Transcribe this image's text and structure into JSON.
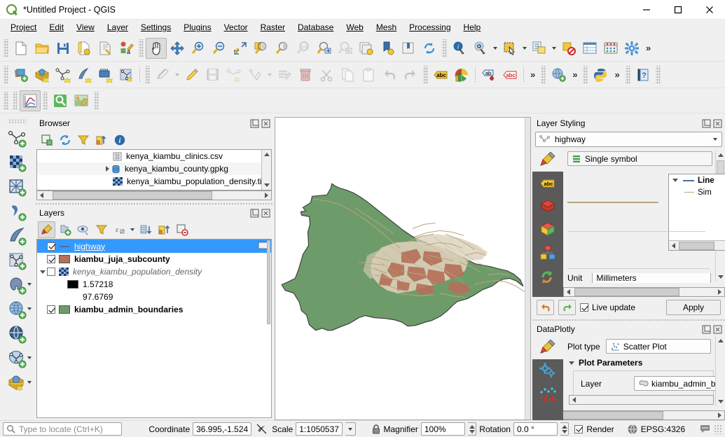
{
  "window": {
    "title": "*Untitled Project - QGIS",
    "app_icon": "qgis-logo",
    "minimize": "minimize-icon",
    "maximize": "maximize-icon",
    "close": "close-icon"
  },
  "menubar": {
    "items": [
      {
        "label": "Project"
      },
      {
        "label": "Edit"
      },
      {
        "label": "View"
      },
      {
        "label": "Layer"
      },
      {
        "label": "Settings"
      },
      {
        "label": "Plugins"
      },
      {
        "label": "Vector"
      },
      {
        "label": "Raster"
      },
      {
        "label": "Database"
      },
      {
        "label": "Web"
      },
      {
        "label": "Mesh"
      },
      {
        "label": "Processing"
      },
      {
        "label": "Help"
      }
    ]
  },
  "toolbar_project": [
    {
      "name": "new-project-icon"
    },
    {
      "name": "open-project-icon"
    },
    {
      "name": "save-project-icon"
    },
    {
      "name": "new-print-layout-icon"
    },
    {
      "name": "style-manager-icon"
    },
    {
      "name": "show-style-manager-icon"
    }
  ],
  "toolbar_navigation": [
    {
      "name": "pan-map-icon",
      "active": true
    },
    {
      "name": "pan-to-selection-icon"
    },
    {
      "name": "zoom-in-icon"
    },
    {
      "name": "zoom-out-icon"
    },
    {
      "name": "zoom-full-icon"
    },
    {
      "name": "zoom-to-selection-icon"
    },
    {
      "name": "zoom-to-layer-icon"
    },
    {
      "name": "zoom-native-icon"
    },
    {
      "name": "zoom-last-icon"
    },
    {
      "name": "zoom-next-icon"
    },
    {
      "name": "refresh-map-icon"
    }
  ],
  "toolbar_attributes": [
    {
      "name": "identify-features-icon"
    },
    {
      "name": "run-feature-action-icon"
    },
    {
      "name": "select-features-icon"
    },
    {
      "name": "select-by-expression-icon"
    },
    {
      "name": "deselect-features-icon"
    },
    {
      "name": "open-attribute-table-icon"
    },
    {
      "name": "statistical-summary-icon"
    },
    {
      "name": "options-icon"
    },
    {
      "name": "overflow-chevron"
    }
  ],
  "toolbar_digitizing": [
    {
      "name": "add-vector-layer-icon"
    },
    {
      "name": "add-raster-layer-icon"
    },
    {
      "name": "add-mesh-layer-icon"
    },
    {
      "name": "add-delimited-text-icon"
    },
    {
      "name": "add-wms-layer-icon"
    },
    {
      "name": "new-shapefile-icon"
    },
    {
      "name": "current-edits-icon"
    },
    {
      "name": "toggle-editing-icon"
    },
    {
      "name": "save-layer-edits-icon"
    },
    {
      "name": "add-feature-icon"
    },
    {
      "name": "vertex-tool-icon"
    },
    {
      "name": "modify-attributes-icon"
    },
    {
      "name": "delete-selected-icon"
    },
    {
      "name": "cut-features-icon"
    },
    {
      "name": "copy-features-icon"
    },
    {
      "name": "paste-features-icon"
    },
    {
      "name": "undo-icon"
    },
    {
      "name": "redo-icon"
    }
  ],
  "toolbar_label": [
    {
      "name": "label-toolbar-icon"
    },
    {
      "name": "diagram-toolbar-icon"
    },
    {
      "name": "pin-labels-icon"
    },
    {
      "name": "highlight-labels-icon"
    },
    {
      "name": "label-overflow-chevron"
    },
    {
      "name": "web-toolbar-icon"
    },
    {
      "name": "web-overflow-chevron"
    },
    {
      "name": "python-console-icon"
    },
    {
      "name": "plugins-overflow-chevron"
    },
    {
      "name": "help-icon"
    }
  ],
  "toolbar_plugins": [
    {
      "name": "dataplotly-icon",
      "active": true
    },
    {
      "name": "qucikosm-search-icon"
    },
    {
      "name": "quickmapservices-icon"
    }
  ],
  "vertical_toolbar": [
    {
      "name": "add-vector-layer-icon"
    },
    {
      "name": "add-raster-layer-icon"
    },
    {
      "name": "add-mesh-layer-icon"
    },
    {
      "name": "add-delimited-text-layer-icon"
    },
    {
      "name": "add-spatialite-layer-icon"
    },
    {
      "name": "new-virtual-layer-icon"
    },
    {
      "name": "add-postgis-layer-icon"
    },
    {
      "name": "add-wms-wmts-layer-icon"
    },
    {
      "name": "add-wfs-layer-icon"
    },
    {
      "name": "add-vectortile-layer-icon"
    },
    {
      "name": "add-geopackage-layer-icon"
    }
  ],
  "browser_panel": {
    "title": "Browser",
    "undock_icon": "undock-icon",
    "close_icon": "close-icon",
    "tools": [
      {
        "name": "add-layer-icon"
      },
      {
        "name": "refresh-icon"
      },
      {
        "name": "filter-browser-icon"
      },
      {
        "name": "collapse-all-icon"
      },
      {
        "name": "properties-icon"
      }
    ],
    "items": [
      {
        "label": "kenya_kiambu_clinics.csv",
        "icon": "csv-file-icon",
        "expandable": false
      },
      {
        "label": "kenya_kiambu_county.gpkg",
        "icon": "geopackage-icon",
        "expandable": true
      },
      {
        "label": "kenya_kiambu_population_density.tif",
        "icon": "raster-file-icon",
        "expandable": false
      }
    ]
  },
  "layers_panel": {
    "title": "Layers",
    "undock_icon": "undock-icon",
    "close_icon": "close-icon",
    "tools": [
      {
        "name": "open-layer-styling-icon",
        "active": true
      },
      {
        "name": "add-group-icon"
      },
      {
        "name": "manage-visibility-icon"
      },
      {
        "name": "filter-legend-icon"
      },
      {
        "name": "filter-legend-by-expression-icon"
      },
      {
        "name": "expand-all-icon"
      },
      {
        "name": "collapse-all-icon"
      },
      {
        "name": "remove-layer-icon"
      }
    ],
    "items": [
      {
        "label": "highway",
        "checked": true,
        "symbol": "line",
        "selected": true,
        "style": "underline",
        "edit_icon": "edit-in-place-icon"
      },
      {
        "label": "kiambu_juja_subcounty",
        "checked": true,
        "symbol": "swatch",
        "color": "#b5705a",
        "style": "bold"
      },
      {
        "label": "kenya_kiambu_population_density",
        "checked": false,
        "symbol": "raster",
        "style": "italic",
        "expanded": true
      },
      {
        "label": "1.57218",
        "symbol": "swatch",
        "color": "#000000",
        "child": true
      },
      {
        "label": "97.6769",
        "symbol": "none",
        "child": true
      },
      {
        "label": "kiambu_admin_boundaries",
        "checked": true,
        "symbol": "swatch",
        "color": "#6e9b6a",
        "style": "bold"
      }
    ]
  },
  "layer_styling_panel": {
    "title": "Layer Styling",
    "undock_icon": "undock-icon",
    "close_icon": "close-icon",
    "layer_selector": {
      "value": "highway",
      "icon": "line-layer-icon"
    },
    "renderer": {
      "value": "Single symbol",
      "icon": "single-symbol-icon"
    },
    "sidebar_icons": [
      {
        "name": "symbology-icon",
        "active": true
      },
      {
        "name": "labels-icon"
      },
      {
        "name": "masks-icon"
      },
      {
        "name": "3d-view-icon"
      },
      {
        "name": "diagrams-icon"
      },
      {
        "name": "history-icon"
      }
    ],
    "symbol_tree": [
      {
        "label": "Line",
        "level": 0,
        "bold": true,
        "expanded": true
      },
      {
        "label": "Sim",
        "level": 1,
        "bold": false
      }
    ],
    "side_buttons": [
      {
        "name": "add-symbol-layer-button"
      },
      {
        "name": "remove-symbol-layer-button"
      },
      {
        "name": "duplicate-symbol-layer-button"
      }
    ],
    "unit_label": "Unit",
    "unit_value": "Millimeters",
    "undo_icon": "undo-icon",
    "redo_icon": "redo-icon",
    "live_update_label": "Live update",
    "live_update_checked": true,
    "apply_label": "Apply"
  },
  "dataplotly_panel": {
    "title": "DataPlotly",
    "undock_icon": "undock-icon",
    "close_icon": "close-icon",
    "sidebar_icons": [
      {
        "name": "plot-type-icon",
        "active": false
      },
      {
        "name": "plot-settings-icon",
        "active": true
      },
      {
        "name": "plot-preview-icon",
        "active": false
      }
    ],
    "plot_type_label": "Plot type",
    "plot_type_value": "Scatter Plot",
    "plot_type_icon": "scatter-plot-icon",
    "parameters_group_label": "Plot Parameters",
    "layer_label": "Layer",
    "layer_value": "kiambu_admin_boun",
    "layer_icon": "polygon-layer-icon"
  },
  "statusbar": {
    "locate_placeholder": "Type to locate (Ctrl+K)",
    "search_icon": "search-icon",
    "coordinate_label": "Coordinate",
    "coordinate_value": "36.995,-1.524",
    "toggle_extents_icon": "toggle-extents-icon",
    "scale_label": "Scale",
    "scale_value": "1:1050537",
    "lock_icon": "lock-icon",
    "magnifier_label": "Magnifier",
    "magnifier_value": "100%",
    "rotation_label": "Rotation",
    "rotation_value": "0.0 °",
    "render_label": "Render",
    "render_checked": true,
    "crs_icon": "crs-globe-icon",
    "crs_value": "EPSG:4326",
    "messages_icon": "messages-icon"
  },
  "map": {
    "background": "#ffffff",
    "admin_fill": "#6e9b6a",
    "admin_stroke": "#3a3a3a",
    "subcounty_fill": "#b5705a",
    "density_fill": "#d8cdb6",
    "highway_color": "#b8a67e"
  }
}
